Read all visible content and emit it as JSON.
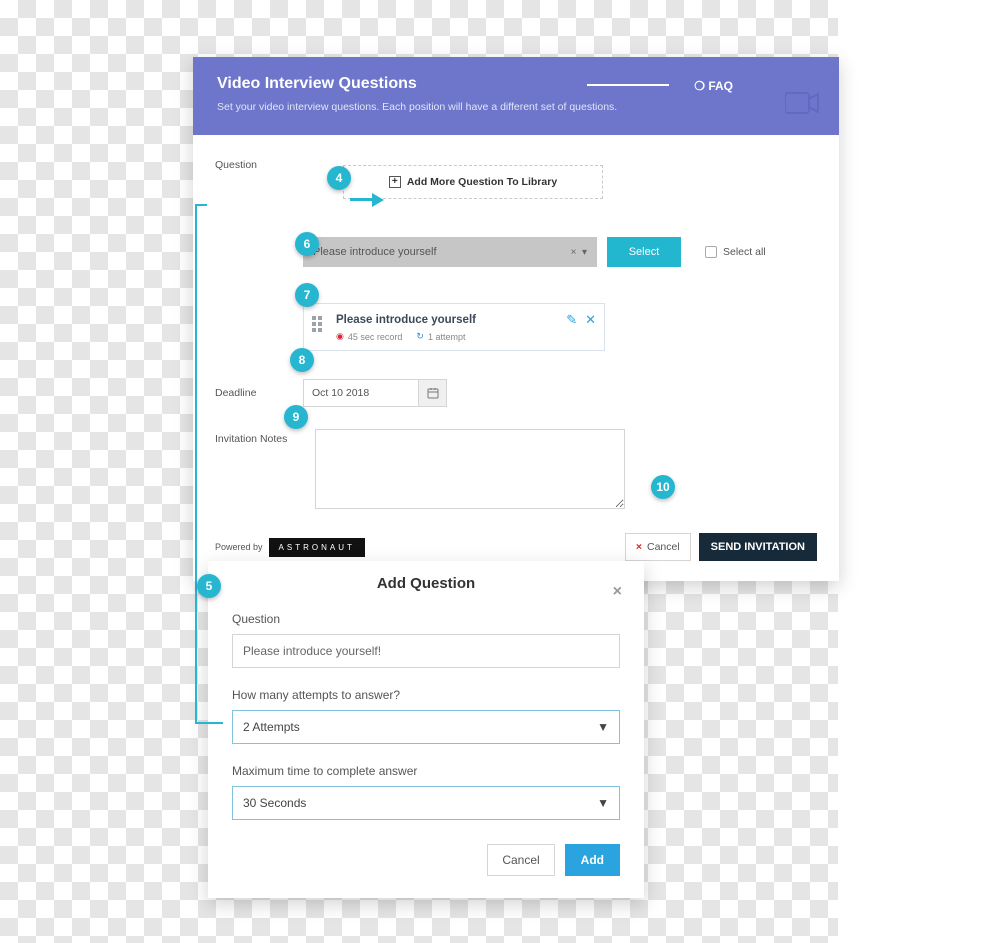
{
  "main": {
    "title": "Video Interview Questions",
    "subtitle": "Set your video interview questions. Each position will have a different set of questions.",
    "faq": "FAQ",
    "question_label": "Question",
    "add_more": "Add More Question To Library",
    "selector_value": "Please introduce yourself",
    "select_btn": "Select",
    "select_all": "Select all",
    "card": {
      "title": "Please introduce yourself",
      "record": "45 sec record",
      "attempt": "1 attempt"
    },
    "deadline_label": "Deadline",
    "deadline_value": "Oct 10 2018",
    "notes_label": "Invitation Notes",
    "powered": "Powered by",
    "brand": "ASTRONAUT",
    "cancel": "Cancel",
    "send": "SEND INVITATION"
  },
  "modal": {
    "title": "Add Question",
    "q_label": "Question",
    "q_value": "Please introduce yourself!",
    "attempts_label": "How many attempts to answer?",
    "attempts_value": "2 Attempts",
    "time_label": "Maximum time to complete answer",
    "time_value": "30 Seconds",
    "cancel": "Cancel",
    "add": "Add"
  },
  "callouts": {
    "c4": "4",
    "c5": "5",
    "c6": "6",
    "c7": "7",
    "c8": "8",
    "c9": "9",
    "c10": "10"
  }
}
